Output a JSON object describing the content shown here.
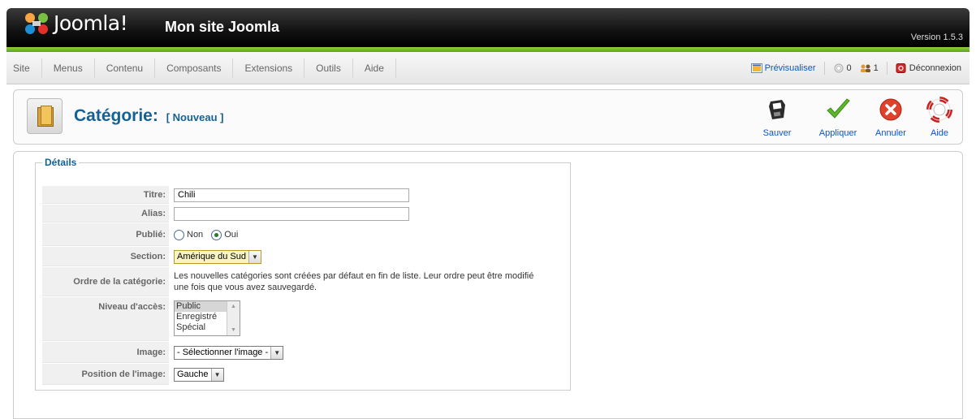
{
  "header": {
    "brand": "Joomla!",
    "site_title": "Mon site Joomla",
    "version": "Version 1.5.3"
  },
  "menu": {
    "items": [
      {
        "label": "Site"
      },
      {
        "label": "Menus"
      },
      {
        "label": "Contenu"
      },
      {
        "label": "Composants"
      },
      {
        "label": "Extensions"
      },
      {
        "label": "Outils"
      },
      {
        "label": "Aide"
      }
    ]
  },
  "status": {
    "preview": "Prévisualiser",
    "messages_count": "0",
    "users_count": "1",
    "logout": "Déconnexion"
  },
  "toolbar": {
    "title": "Catégorie:",
    "title_suffix": "[ Nouveau ]",
    "save": "Sauver",
    "apply": "Appliquer",
    "cancel": "Annuler",
    "help": "Aide"
  },
  "details": {
    "legend": "Détails",
    "title_label": "Titre:",
    "title_value": "Chili",
    "alias_label": "Alias:",
    "alias_value": "",
    "published_label": "Publié:",
    "published_no": "Non",
    "published_yes": "Oui",
    "published_value": "Oui",
    "section_label": "Section:",
    "section_value": "Amérique du Sud",
    "order_label": "Ordre de la catégorie:",
    "order_text_1": "Les nouvelles catégories sont créées par défaut en fin de liste. Leur ordre peut être modifié",
    "order_text_2": "une fois que vous avez sauvegardé.",
    "access_label": "Niveau d'accès:",
    "access_options": [
      "Public",
      "Enregistré",
      "Spécial"
    ],
    "access_selected": "Public",
    "image_label": "Image:",
    "image_value": "- Sélectionner l'image -",
    "image_position_label": "Position de l'image:",
    "image_position_value": "Gauche"
  },
  "colors": {
    "accent": "#146295",
    "link": "#0b55c4",
    "header_green": "#6cbb22"
  }
}
